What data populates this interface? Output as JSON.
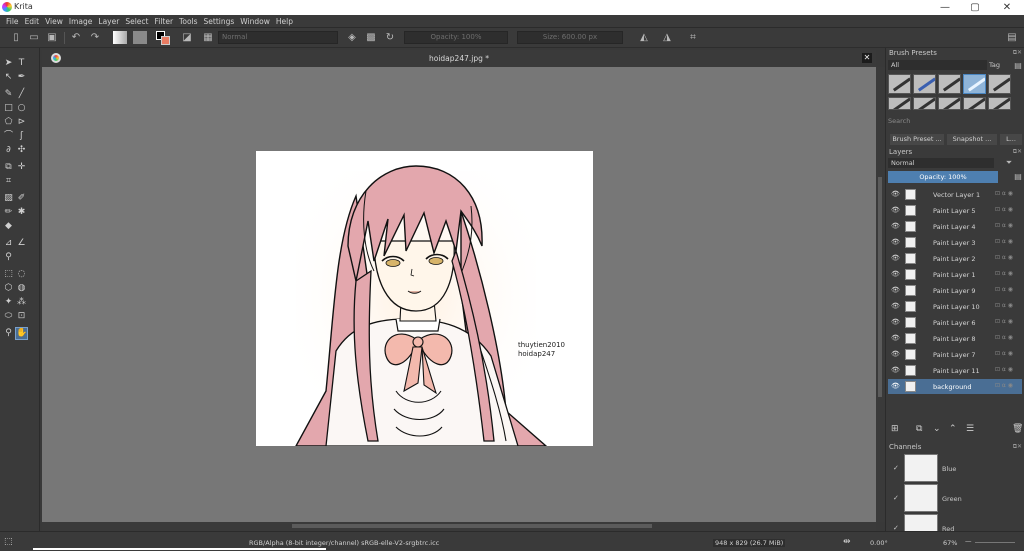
{
  "window": {
    "title": "Krita",
    "minimize": "—",
    "maximize": "▢",
    "close": "✕"
  },
  "menu": [
    "File",
    "Edit",
    "View",
    "Image",
    "Layer",
    "Select",
    "Filter",
    "Tools",
    "Settings",
    "Window",
    "Help"
  ],
  "toolbar": {
    "blend_mode": "Normal",
    "opacity": "Opacity: 100%",
    "size": "Size: 600.00 px"
  },
  "document": {
    "title": "hoidap247.jpg *",
    "watermark_line1": "thuytien2010",
    "watermark_line2": "hoidap247"
  },
  "brush_presets": {
    "title": "Brush Presets",
    "filter": "All",
    "tag": "Tag",
    "search_placeholder": "Search"
  },
  "dock_tabs": [
    "Brush Preset ...",
    "Snapshot ...",
    "L..."
  ],
  "layers_panel": {
    "title": "Layers",
    "blend_mode": "Normal",
    "opacity": "Opacity:  100%",
    "layers": [
      {
        "name": "Vector Layer 1",
        "selected": false
      },
      {
        "name": "Paint Layer 5",
        "selected": false
      },
      {
        "name": "Paint Layer 4",
        "selected": false
      },
      {
        "name": "Paint Layer 3",
        "selected": false
      },
      {
        "name": "Paint Layer 2",
        "selected": false
      },
      {
        "name": "Paint Layer 1",
        "selected": false
      },
      {
        "name": "Paint Layer 9",
        "selected": false
      },
      {
        "name": "Paint Layer 10",
        "selected": false
      },
      {
        "name": "Paint Layer 6",
        "selected": false
      },
      {
        "name": "Paint Layer 8",
        "selected": false
      },
      {
        "name": "Paint Layer 7",
        "selected": false
      },
      {
        "name": "Paint Layer 11",
        "selected": false
      },
      {
        "name": "background",
        "selected": true
      }
    ]
  },
  "channels_panel": {
    "title": "Channels",
    "channels": [
      {
        "name": "Blue"
      },
      {
        "name": "Green"
      },
      {
        "name": "Red"
      }
    ]
  },
  "status": {
    "color_info": "RGB/Alpha (8-bit integer/channel)  sRGB-elle-V2-srgbtrc.icc",
    "dimensions": "948 x 829 (26.7 MiB)",
    "rotation": "0.00°",
    "zoom": "67%"
  },
  "colors": {
    "accent": "#4a6e94",
    "opacity_bar": "#4e7fb0",
    "canvas_bg": "#777777",
    "panel_bg": "#3a3a3a",
    "hair": "#e3a7ad"
  }
}
